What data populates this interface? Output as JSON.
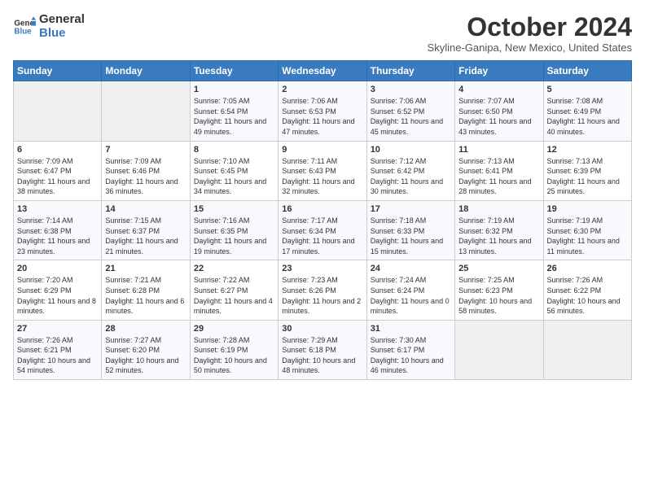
{
  "header": {
    "logo_line1": "General",
    "logo_line2": "Blue",
    "month_title": "October 2024",
    "subtitle": "Skyline-Ganipa, New Mexico, United States"
  },
  "days_of_week": [
    "Sunday",
    "Monday",
    "Tuesday",
    "Wednesday",
    "Thursday",
    "Friday",
    "Saturday"
  ],
  "weeks": [
    [
      {
        "day": "",
        "info": ""
      },
      {
        "day": "",
        "info": ""
      },
      {
        "day": "1",
        "info": "Sunrise: 7:05 AM\nSunset: 6:54 PM\nDaylight: 11 hours and 49 minutes."
      },
      {
        "day": "2",
        "info": "Sunrise: 7:06 AM\nSunset: 6:53 PM\nDaylight: 11 hours and 47 minutes."
      },
      {
        "day": "3",
        "info": "Sunrise: 7:06 AM\nSunset: 6:52 PM\nDaylight: 11 hours and 45 minutes."
      },
      {
        "day": "4",
        "info": "Sunrise: 7:07 AM\nSunset: 6:50 PM\nDaylight: 11 hours and 43 minutes."
      },
      {
        "day": "5",
        "info": "Sunrise: 7:08 AM\nSunset: 6:49 PM\nDaylight: 11 hours and 40 minutes."
      }
    ],
    [
      {
        "day": "6",
        "info": "Sunrise: 7:09 AM\nSunset: 6:47 PM\nDaylight: 11 hours and 38 minutes."
      },
      {
        "day": "7",
        "info": "Sunrise: 7:09 AM\nSunset: 6:46 PM\nDaylight: 11 hours and 36 minutes."
      },
      {
        "day": "8",
        "info": "Sunrise: 7:10 AM\nSunset: 6:45 PM\nDaylight: 11 hours and 34 minutes."
      },
      {
        "day": "9",
        "info": "Sunrise: 7:11 AM\nSunset: 6:43 PM\nDaylight: 11 hours and 32 minutes."
      },
      {
        "day": "10",
        "info": "Sunrise: 7:12 AM\nSunset: 6:42 PM\nDaylight: 11 hours and 30 minutes."
      },
      {
        "day": "11",
        "info": "Sunrise: 7:13 AM\nSunset: 6:41 PM\nDaylight: 11 hours and 28 minutes."
      },
      {
        "day": "12",
        "info": "Sunrise: 7:13 AM\nSunset: 6:39 PM\nDaylight: 11 hours and 25 minutes."
      }
    ],
    [
      {
        "day": "13",
        "info": "Sunrise: 7:14 AM\nSunset: 6:38 PM\nDaylight: 11 hours and 23 minutes."
      },
      {
        "day": "14",
        "info": "Sunrise: 7:15 AM\nSunset: 6:37 PM\nDaylight: 11 hours and 21 minutes."
      },
      {
        "day": "15",
        "info": "Sunrise: 7:16 AM\nSunset: 6:35 PM\nDaylight: 11 hours and 19 minutes."
      },
      {
        "day": "16",
        "info": "Sunrise: 7:17 AM\nSunset: 6:34 PM\nDaylight: 11 hours and 17 minutes."
      },
      {
        "day": "17",
        "info": "Sunrise: 7:18 AM\nSunset: 6:33 PM\nDaylight: 11 hours and 15 minutes."
      },
      {
        "day": "18",
        "info": "Sunrise: 7:19 AM\nSunset: 6:32 PM\nDaylight: 11 hours and 13 minutes."
      },
      {
        "day": "19",
        "info": "Sunrise: 7:19 AM\nSunset: 6:30 PM\nDaylight: 11 hours and 11 minutes."
      }
    ],
    [
      {
        "day": "20",
        "info": "Sunrise: 7:20 AM\nSunset: 6:29 PM\nDaylight: 11 hours and 8 minutes."
      },
      {
        "day": "21",
        "info": "Sunrise: 7:21 AM\nSunset: 6:28 PM\nDaylight: 11 hours and 6 minutes."
      },
      {
        "day": "22",
        "info": "Sunrise: 7:22 AM\nSunset: 6:27 PM\nDaylight: 11 hours and 4 minutes."
      },
      {
        "day": "23",
        "info": "Sunrise: 7:23 AM\nSunset: 6:26 PM\nDaylight: 11 hours and 2 minutes."
      },
      {
        "day": "24",
        "info": "Sunrise: 7:24 AM\nSunset: 6:24 PM\nDaylight: 11 hours and 0 minutes."
      },
      {
        "day": "25",
        "info": "Sunrise: 7:25 AM\nSunset: 6:23 PM\nDaylight: 10 hours and 58 minutes."
      },
      {
        "day": "26",
        "info": "Sunrise: 7:26 AM\nSunset: 6:22 PM\nDaylight: 10 hours and 56 minutes."
      }
    ],
    [
      {
        "day": "27",
        "info": "Sunrise: 7:26 AM\nSunset: 6:21 PM\nDaylight: 10 hours and 54 minutes."
      },
      {
        "day": "28",
        "info": "Sunrise: 7:27 AM\nSunset: 6:20 PM\nDaylight: 10 hours and 52 minutes."
      },
      {
        "day": "29",
        "info": "Sunrise: 7:28 AM\nSunset: 6:19 PM\nDaylight: 10 hours and 50 minutes."
      },
      {
        "day": "30",
        "info": "Sunrise: 7:29 AM\nSunset: 6:18 PM\nDaylight: 10 hours and 48 minutes."
      },
      {
        "day": "31",
        "info": "Sunrise: 7:30 AM\nSunset: 6:17 PM\nDaylight: 10 hours and 46 minutes."
      },
      {
        "day": "",
        "info": ""
      },
      {
        "day": "",
        "info": ""
      }
    ]
  ]
}
